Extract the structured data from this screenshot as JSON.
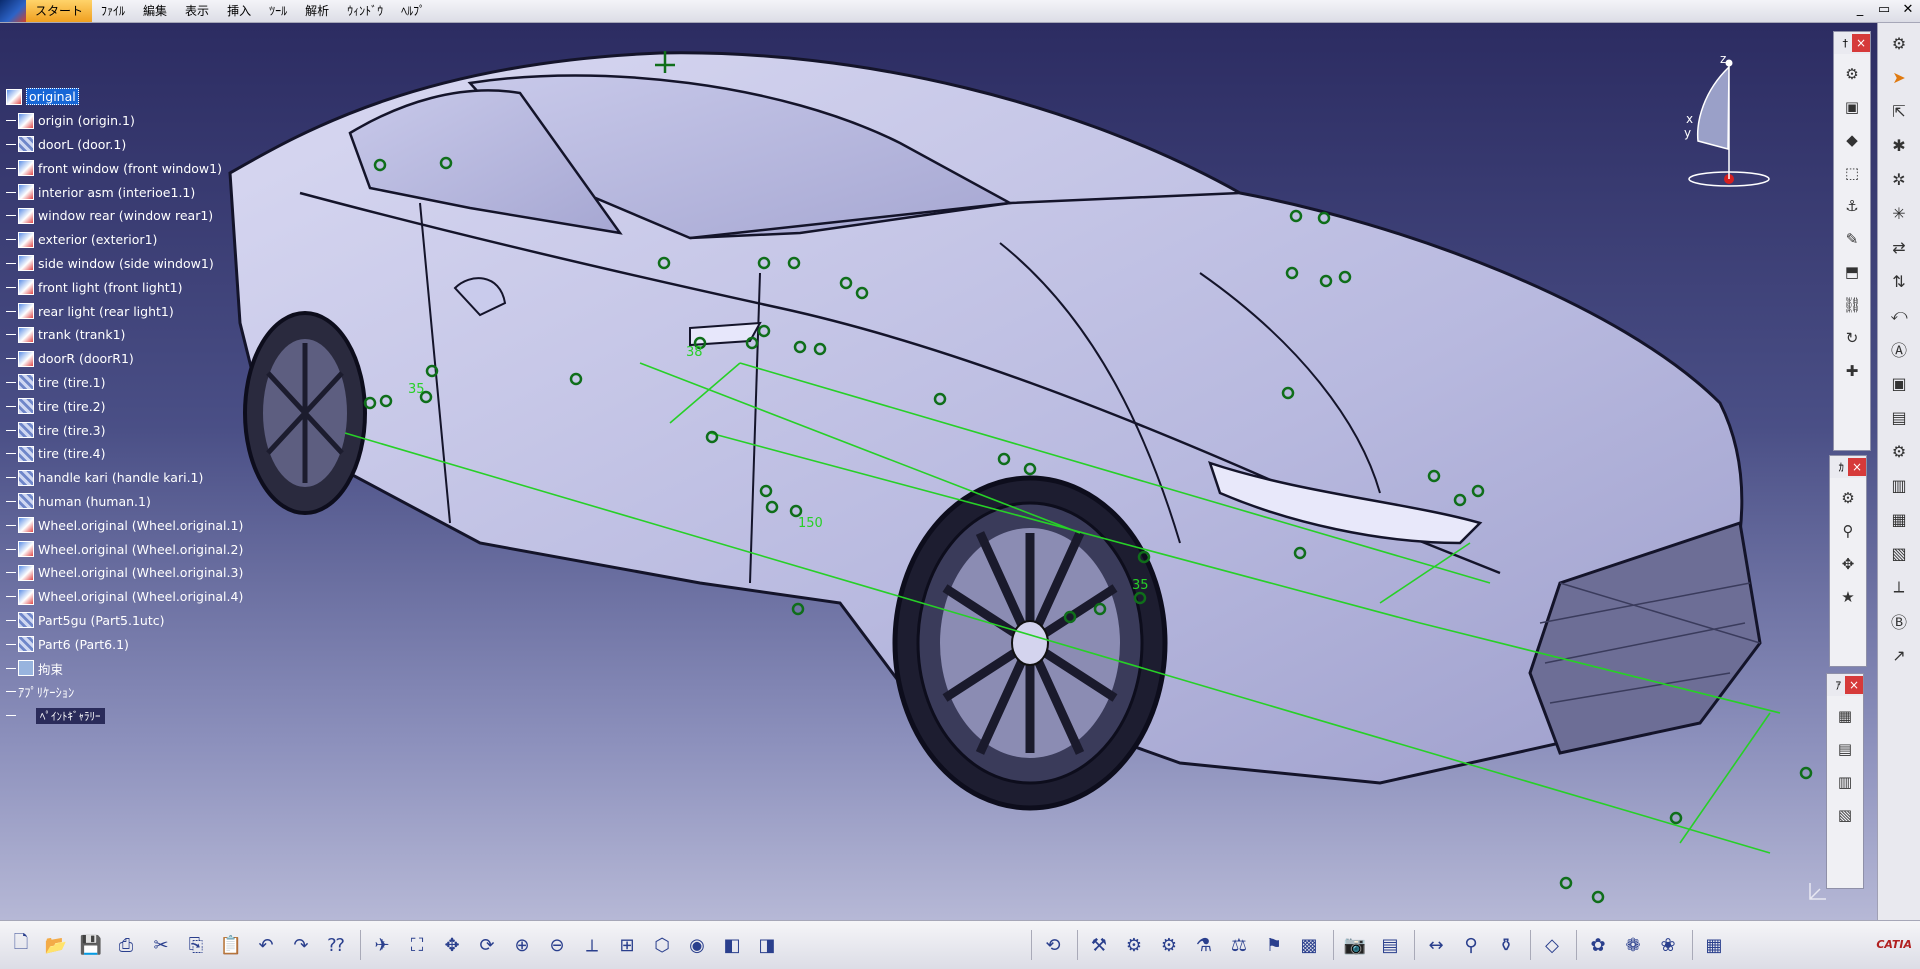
{
  "menu": {
    "items": [
      "スタート",
      "ﾌｧｲﾙ",
      "編集",
      "表示",
      "挿入",
      "ﾂｰﾙ",
      "解析",
      "ｳｨﾝﾄﾞｳ",
      "ﾍﾙﾌﾟ"
    ],
    "active_index": 0
  },
  "window_controls": [
    "_",
    "▭",
    "✕"
  ],
  "spec_tree": {
    "root": "original",
    "nodes": [
      {
        "label": "origin (origin.1)",
        "type": "product"
      },
      {
        "label": "doorL (door.1)",
        "type": "part"
      },
      {
        "label": "front window (front window1)",
        "type": "product"
      },
      {
        "label": "interior asm (interioe1.1)",
        "type": "product"
      },
      {
        "label": "window rear (window rear1)",
        "type": "product"
      },
      {
        "label": "exterior (exterior1)",
        "type": "product"
      },
      {
        "label": "side window (side window1)",
        "type": "product"
      },
      {
        "label": "front light (front light1)",
        "type": "product"
      },
      {
        "label": "rear light (rear light1)",
        "type": "product"
      },
      {
        "label": "trank (trank1)",
        "type": "product"
      },
      {
        "label": "doorR (doorR1)",
        "type": "product"
      },
      {
        "label": "tire (tire.1)",
        "type": "part"
      },
      {
        "label": "tire (tire.2)",
        "type": "part"
      },
      {
        "label": "tire (tire.3)",
        "type": "part"
      },
      {
        "label": "tire (tire.4)",
        "type": "part"
      },
      {
        "label": "handle kari (handle kari.1)",
        "type": "part"
      },
      {
        "label": "human (human.1)",
        "type": "part"
      },
      {
        "label": "Wheel.original (Wheel.original.1)",
        "type": "product"
      },
      {
        "label": "Wheel.original (Wheel.original.2)",
        "type": "product"
      },
      {
        "label": "Wheel.original (Wheel.original.3)",
        "type": "product"
      },
      {
        "label": "Wheel.original (Wheel.original.4)",
        "type": "product"
      },
      {
        "label": "Part5gu (Part5.1utc)",
        "type": "part"
      },
      {
        "label": "Part6 (Part6.1)",
        "type": "part"
      },
      {
        "label": "拘束",
        "type": "constraint"
      },
      {
        "label": "ｱﾌﾟﾘｹｰｼｮﾝ",
        "type": "app"
      },
      {
        "label": "ﾍﾟｲﾝﾄｷﾞｬﾗﾘｰ",
        "type": "sub"
      }
    ]
  },
  "compass": {
    "axes": [
      "z",
      "x",
      "y"
    ]
  },
  "dimensions": [
    "38",
    "35",
    "150",
    "35"
  ],
  "floating_toolbars": [
    {
      "title": "†"
    },
    {
      "title": "ｶ"
    },
    {
      "title": "ｱ"
    }
  ],
  "brand": "CATIA",
  "colors": {
    "viewport_top": "#2c2c62",
    "viewport_bottom": "#b6b8d6",
    "dimension_green": "#27d027",
    "highlight": "#1766d6",
    "close_button": "#d63a3a"
  }
}
